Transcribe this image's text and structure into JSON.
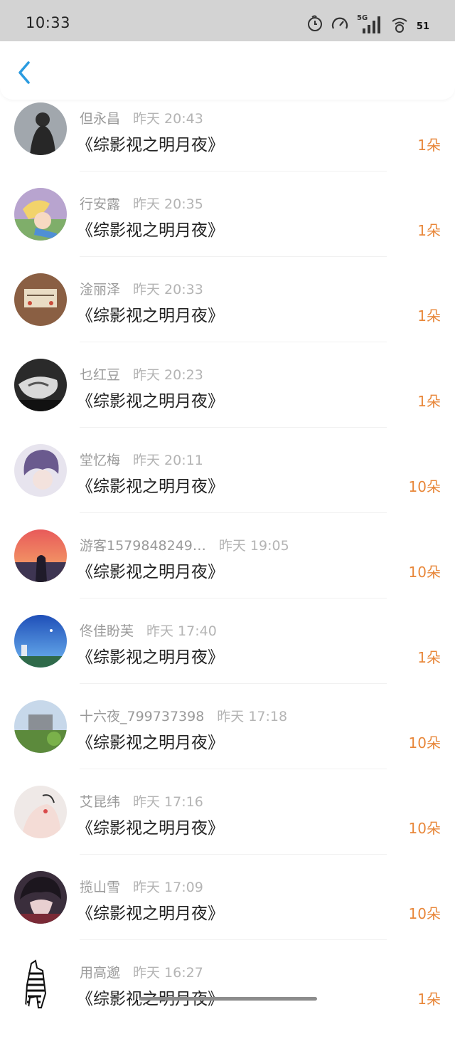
{
  "status_bar": {
    "time": "10:33",
    "icons": [
      "alarm-clock-icon",
      "speedometer-icon",
      "5g-signal-icon",
      "wifi-icon",
      "battery-icon"
    ],
    "network_label": "5G",
    "battery": "51"
  },
  "nav": {
    "back_icon": "chevron-left-icon",
    "accent": "#2a9be0"
  },
  "colors": {
    "amount": "#e8873a",
    "name": "#9a9a9a",
    "title": "#222222"
  },
  "records": [
    {
      "name": "但永昌",
      "time": "昨天 20:43",
      "title": "《综影视之明月夜》",
      "amount": "1朵"
    },
    {
      "name": "行安露",
      "time": "昨天 20:35",
      "title": "《综影视之明月夜》",
      "amount": "1朵"
    },
    {
      "name": "淦丽泽",
      "time": "昨天 20:33",
      "title": "《综影视之明月夜》",
      "amount": "1朵"
    },
    {
      "name": "乜红豆",
      "time": "昨天 20:23",
      "title": "《综影视之明月夜》",
      "amount": "1朵"
    },
    {
      "name": "堂忆梅",
      "time": "昨天 20:11",
      "title": "《综影视之明月夜》",
      "amount": "10朵"
    },
    {
      "name": "游客1579848249…",
      "time": "昨天 19:05",
      "title": "《综影视之明月夜》",
      "amount": "10朵"
    },
    {
      "name": "佟佳盼芙",
      "time": "昨天 17:40",
      "title": "《综影视之明月夜》",
      "amount": "1朵"
    },
    {
      "name": "十六夜_799737398",
      "time": "昨天 17:18",
      "title": "《综影视之明月夜》",
      "amount": "10朵"
    },
    {
      "name": "艾昆纬",
      "time": "昨天 17:16",
      "title": "《综影视之明月夜》",
      "amount": "10朵"
    },
    {
      "name": "揽山雪",
      "time": "昨天 17:09",
      "title": "《综影视之明月夜》",
      "amount": "10朵"
    },
    {
      "name": "用高邈",
      "time": "昨天 16:27",
      "title": "《综影视之明月夜》",
      "amount": "1朵"
    }
  ]
}
